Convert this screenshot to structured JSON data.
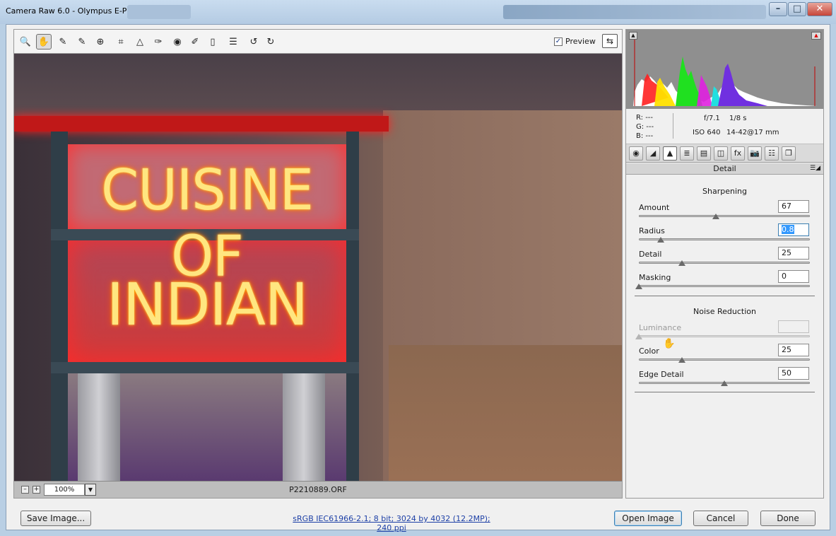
{
  "window": {
    "title": "Camera Raw 6.0  -  Olympus E-P2",
    "controls": {
      "minimize": "–",
      "maximize": "□",
      "close": "✕"
    }
  },
  "toolbar": {
    "tools": [
      {
        "name": "zoom-tool-icon",
        "glyph": "🔍"
      },
      {
        "name": "hand-tool-icon",
        "glyph": "✋",
        "active": true
      },
      {
        "name": "white-balance-tool-icon",
        "glyph": "✎"
      },
      {
        "name": "color-sampler-tool-icon",
        "glyph": "✎"
      },
      {
        "name": "targeted-adjustment-tool-icon",
        "glyph": "⊕"
      },
      {
        "name": "crop-tool-icon",
        "glyph": "⌗"
      },
      {
        "name": "straighten-tool-icon",
        "glyph": "△"
      },
      {
        "name": "spot-removal-tool-icon",
        "glyph": "✑"
      },
      {
        "name": "red-eye-tool-icon",
        "glyph": "◉"
      },
      {
        "name": "adjustment-brush-icon",
        "glyph": "✐"
      },
      {
        "name": "graduated-filter-icon",
        "glyph": "▯"
      },
      {
        "name": "preferences-icon",
        "glyph": "☰"
      },
      {
        "name": "rotate-left-icon",
        "glyph": "↺"
      },
      {
        "name": "rotate-right-icon",
        "glyph": "↻"
      }
    ],
    "preview_label": "Preview",
    "preview_checked": "✓",
    "fullscreen_glyph": "⇆"
  },
  "photo": {
    "line1": "CUISINE OF",
    "line2": "INDIAN"
  },
  "statusbar": {
    "zoom_out": "–",
    "zoom_in": "+",
    "zoom": "100%",
    "zoom_dropdown": "▼",
    "filename": "P2210889.ORF"
  },
  "histogram": {
    "clip_left": "▲",
    "clip_right": "▲"
  },
  "info": {
    "r": "R:   ---",
    "g": "G:   ---",
    "b": "B:   ---",
    "aperture": "f/7.1",
    "shutter": "1/8 s",
    "iso": "ISO 640",
    "lens": "14-42@17 mm"
  },
  "panel_tabs": [
    "◉",
    "◢",
    "▲",
    "≣",
    "▤",
    "◫",
    "fx",
    "📷",
    "☷",
    "❐"
  ],
  "panel": {
    "title": "Detail",
    "menu": "☰◢",
    "sharpening": {
      "title": "Sharpening",
      "controls": [
        {
          "label": "Amount",
          "value": "67",
          "pos": 0.45
        },
        {
          "label": "Radius",
          "value": "0.8",
          "pos": 0.13,
          "selected": true
        },
        {
          "label": "Detail",
          "value": "25",
          "pos": 0.25
        },
        {
          "label": "Masking",
          "value": "0",
          "pos": 0.0
        }
      ]
    },
    "noise": {
      "title": "Noise Reduction",
      "controls": [
        {
          "label": "Luminance",
          "value": "",
          "pos": 0.0,
          "disabled": true
        },
        {
          "label": "Color",
          "value": "25",
          "pos": 0.25
        },
        {
          "label": "Edge Detail",
          "value": "50",
          "pos": 0.5
        }
      ]
    }
  },
  "footer": {
    "save": "Save Image...",
    "workflow": "sRGB IEC61966-2.1; 8 bit; 3024 by 4032 (12.2MP); 240 ppi",
    "open": "Open Image",
    "cancel": "Cancel",
    "done": "Done"
  },
  "colors": {
    "accent": "#3c7fb1",
    "link": "#1c3fa6",
    "selection": "#3399ff"
  }
}
